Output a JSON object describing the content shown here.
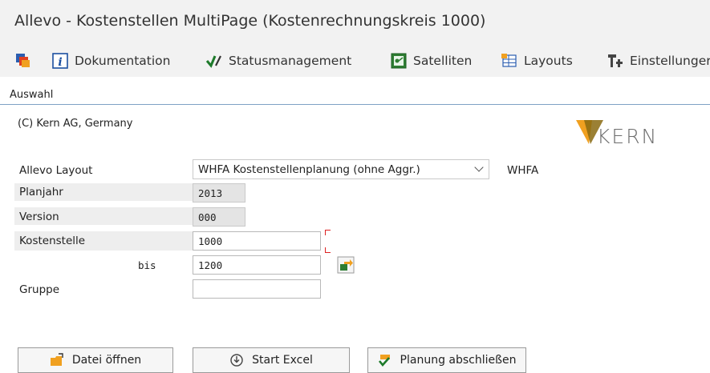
{
  "window": {
    "title": "Allevo - Kostenstellen MultiPage (Kostenrechnungskreis 1000)"
  },
  "toolbar": {
    "items": [
      {
        "icon": "multi-window-icon",
        "label": ""
      },
      {
        "icon": "info-icon",
        "label": "Dokumentation"
      },
      {
        "icon": "checkmark-pencil-icon",
        "label": "Statusmanagement"
      },
      {
        "icon": "satellite-icon",
        "label": "Satelliten"
      },
      {
        "icon": "layout-grid-icon",
        "label": "Layouts"
      },
      {
        "icon": "settings-sliders-icon",
        "label": "Einstellunger"
      }
    ]
  },
  "tab": {
    "label": "Auswahl"
  },
  "header": {
    "copyright": "(C) Kern AG, Germany",
    "logo_text": "KERN"
  },
  "form": {
    "layout": {
      "label": "Allevo Layout",
      "value": "WHFA Kostenstellenplanung (ohne Aggr.)",
      "code": "WHFA"
    },
    "planjahr": {
      "label": "Planjahr",
      "value": "2013"
    },
    "version": {
      "label": "Version",
      "value": "000"
    },
    "kostenstelle": {
      "label": "Kostenstelle",
      "from": "1000",
      "to_label": "bis",
      "to": "1200"
    },
    "gruppe": {
      "label": "Gruppe",
      "value": ""
    }
  },
  "buttons": {
    "open_file": "Datei öffnen",
    "start_excel": "Start Excel",
    "close_planning": "Planung abschließen"
  },
  "colors": {
    "accent_orange": "#f0a020",
    "logo_grey": "#6d6d6d",
    "tab_border": "#7fa1c4"
  }
}
